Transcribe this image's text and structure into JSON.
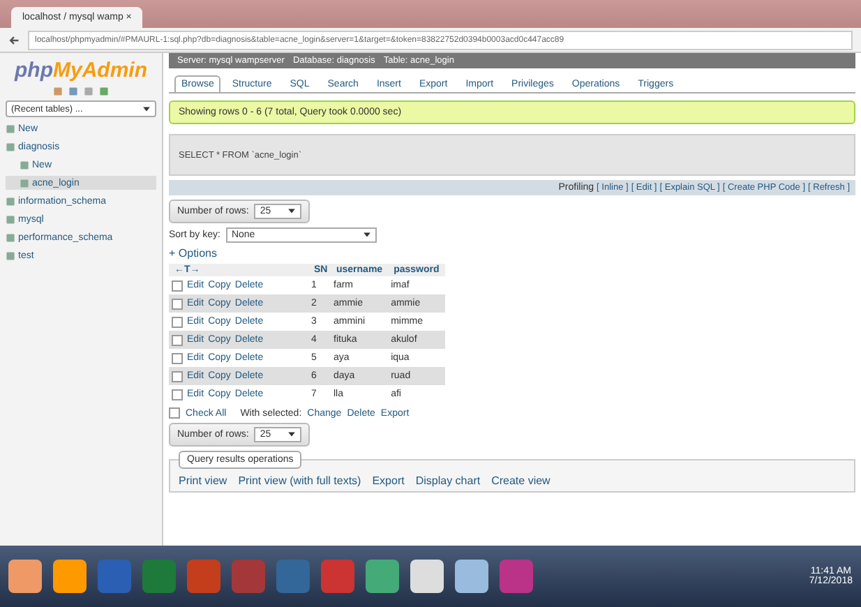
{
  "browser": {
    "tab_title": "localhost / mysql wamp ×",
    "url": "localhost/phpmyadmin/#PMAURL-1:sql.php?db=diagnosis&table=acne_login&server=1&target=&token=83822752d0394b0003acd0c447acc89"
  },
  "sidebar": {
    "logo_php": "php",
    "logo_myadmin": "MyAdmin",
    "recent": "(Recent tables) ...",
    "tree": [
      {
        "label": "New",
        "selected": false
      },
      {
        "label": "diagnosis",
        "selected": false,
        "children": [
          {
            "label": "New",
            "selected": false
          },
          {
            "label": "acne_login",
            "selected": true
          }
        ]
      },
      {
        "label": "information_schema",
        "selected": false
      },
      {
        "label": "mysql",
        "selected": false
      },
      {
        "label": "performance_schema",
        "selected": false
      },
      {
        "label": "test",
        "selected": false
      }
    ]
  },
  "breadcrumb": [
    "Server: mysql wampserver",
    "Database: diagnosis",
    "Table: acne_login"
  ],
  "tabs": [
    {
      "label": "Browse",
      "selected": true
    },
    {
      "label": "Structure",
      "selected": false
    },
    {
      "label": "SQL",
      "selected": false
    },
    {
      "label": "Search",
      "selected": false
    },
    {
      "label": "Insert",
      "selected": false
    },
    {
      "label": "Export",
      "selected": false
    },
    {
      "label": "Import",
      "selected": false
    },
    {
      "label": "Privileges",
      "selected": false
    },
    {
      "label": "Operations",
      "selected": false
    },
    {
      "label": "Triggers",
      "selected": false
    }
  ],
  "message": "Showing rows 0 - 6 (7 total, Query took 0.0000 sec)",
  "sql": "SELECT * FROM `acne_login`",
  "profiling": {
    "label": "Profiling",
    "links": [
      "[ Inline ]",
      "[ Edit ]",
      "[ Explain SQL ]",
      "[ Create PHP Code ]",
      "[ Refresh ]"
    ]
  },
  "number_of_rows": {
    "label": "Number of rows:",
    "value": "25"
  },
  "sort_by_key": {
    "label": "Sort by key:",
    "value": "None"
  },
  "options": "+ Options",
  "table": {
    "arrows": "←T→",
    "columns": [
      "SN",
      "username",
      "password"
    ],
    "rows": [
      {
        "checked": false,
        "actions": [
          "Edit",
          "Copy",
          "Delete"
        ],
        "cells": [
          "1",
          "farm",
          "imaf"
        ]
      },
      {
        "checked": false,
        "actions": [
          "Edit",
          "Copy",
          "Delete"
        ],
        "cells": [
          "2",
          "ammie",
          "ammie"
        ]
      },
      {
        "checked": false,
        "actions": [
          "Edit",
          "Copy",
          "Delete"
        ],
        "cells": [
          "3",
          "ammini",
          "mimme"
        ]
      },
      {
        "checked": false,
        "actions": [
          "Edit",
          "Copy",
          "Delete"
        ],
        "cells": [
          "4",
          "fituka",
          "akulof"
        ]
      },
      {
        "checked": false,
        "actions": [
          "Edit",
          "Copy",
          "Delete"
        ],
        "cells": [
          "5",
          "aya",
          "iqua"
        ]
      },
      {
        "checked": false,
        "actions": [
          "Edit",
          "Copy",
          "Delete"
        ],
        "cells": [
          "6",
          "daya",
          "ruad"
        ]
      },
      {
        "checked": false,
        "actions": [
          "Edit",
          "Copy",
          "Delete"
        ],
        "cells": [
          "7",
          "lla",
          "afi"
        ]
      }
    ]
  },
  "bulk": {
    "check_all": "Check All",
    "checked": false,
    "with_selected": "With selected:",
    "actions": [
      "Change",
      "Delete",
      "Export"
    ]
  },
  "number_of_rows_bottom": {
    "label": "Number of rows:",
    "value": "25"
  },
  "query_ops": {
    "legend": "Query results operations",
    "actions": [
      "Print view",
      "Print view (with full texts)",
      "Export",
      "Display chart",
      "Create view"
    ]
  },
  "taskbar": {
    "time": "11:41 AM",
    "date": "7/12/2018"
  }
}
